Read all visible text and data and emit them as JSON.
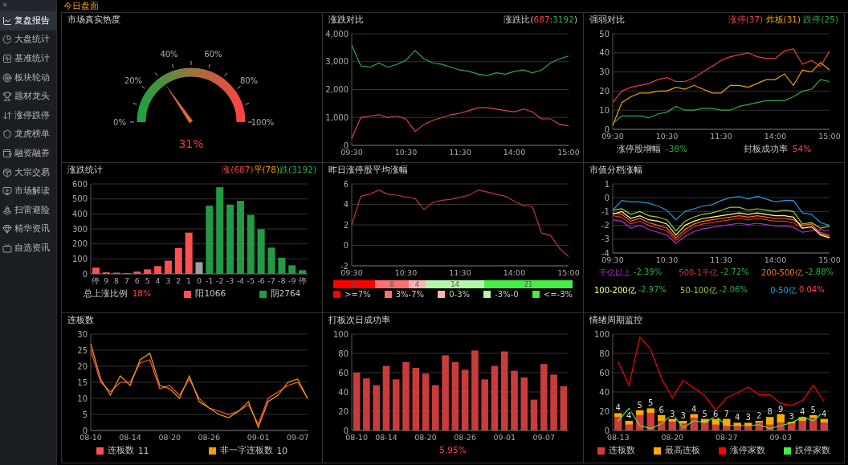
{
  "sidebar": {
    "collapse_icon": "«",
    "items": [
      {
        "label": "复盘报告",
        "selected": true
      },
      {
        "label": "大盘统计",
        "selected": false
      },
      {
        "label": "基准统计",
        "selected": false
      },
      {
        "label": "板块轮动",
        "selected": false
      },
      {
        "label": "题材龙头",
        "selected": false
      },
      {
        "label": "涨停跌停",
        "selected": false
      },
      {
        "label": "龙虎榜单",
        "selected": false
      },
      {
        "label": "融资融券",
        "selected": false
      },
      {
        "label": "大宗交易",
        "selected": false
      },
      {
        "label": "市场解读",
        "selected": false
      },
      {
        "label": "扫雷避险",
        "selected": false
      },
      {
        "label": "精华资讯",
        "selected": false
      },
      {
        "label": "自选资讯",
        "selected": false
      }
    ]
  },
  "header": {
    "title": "今日盘面"
  },
  "panels": [
    {
      "kind": "gauge",
      "title": "市场真实热度",
      "gauge": {
        "level": 0.31,
        "reading": "31%",
        "tick_labels": [
          "0%",
          "20%",
          "40%",
          "60%",
          "80%",
          "100%"
        ]
      }
    },
    {
      "kind": "chart",
      "title": "涨跌对比",
      "header_parts": [
        {
          "text": "涨跌比("
        },
        {
          "text": "687",
          "color": "#ff4040"
        },
        {
          "text": ":"
        },
        {
          "text": "3192",
          "color": "#2eaa4a"
        },
        {
          "text": ")"
        }
      ],
      "chart_data": {
        "type": "line",
        "grid": true,
        "categories": [
          "09:30",
          null,
          null,
          null,
          null,
          null,
          "10:30",
          null,
          null,
          null,
          null,
          null,
          "11:30",
          null,
          null,
          null,
          null,
          null,
          "14:00",
          null,
          null,
          null,
          null,
          null,
          "15:00"
        ],
        "ylim": [
          0,
          4000
        ],
        "yticks": [
          0,
          {
            "value": 1000,
            "label": "1,000"
          },
          {
            "value": 2000,
            "label": "2,000"
          },
          {
            "value": 3000,
            "label": "3,000"
          },
          {
            "value": 4000,
            "label": "4,000"
          }
        ],
        "series": [
          {
            "color": "#e84040",
            "values": [
              250,
              1000,
              1050,
              1100,
              1000,
              1050,
              950,
              500,
              750,
              900,
              1000,
              1100,
              1150,
              1250,
              1350,
              1350,
              1300,
              1250,
              1200,
              1300,
              1200,
              950,
              950,
              750,
              700
            ]
          },
          {
            "color": "#2eaa4a",
            "values": [
              3600,
              2850,
              2800,
              2950,
              2800,
              2900,
              3050,
              3400,
              3100,
              2950,
              2900,
              2800,
              2700,
              2650,
              2550,
              2500,
              2600,
              2550,
              2650,
              2700,
              2600,
              2700,
              2950,
              3100,
              3200
            ]
          }
        ]
      }
    },
    {
      "kind": "chart",
      "title": "强弱对比",
      "series_in_header": true,
      "chart_data": {
        "type": "line",
        "grid": true,
        "categories": [
          "09:30",
          null,
          null,
          null,
          null,
          null,
          "10:30",
          null,
          null,
          null,
          null,
          null,
          "11:30",
          null,
          null,
          null,
          null,
          null,
          "14:00",
          null,
          null,
          null,
          null,
          null,
          "15:00"
        ],
        "ylim": [
          0,
          50
        ],
        "yticks": [
          0,
          10,
          20,
          30,
          40,
          50
        ],
        "series": [
          {
            "name": "涨停(37)",
            "color": "#e84040",
            "values": [
              14,
              20,
              22,
              23,
              24,
              26,
              27,
              25,
              25,
              27,
              30,
              33,
              36,
              38,
              39,
              40,
              38,
              37,
              37,
              41,
              42,
              34,
              36,
              33,
              41
            ]
          },
          {
            "name": "炸板(31)",
            "color": "#f0a000",
            "values": [
              2,
              14,
              17,
              19,
              19,
              20,
              20,
              22,
              21,
              23,
              21,
              19,
              19,
              23,
              23,
              22,
              24,
              26,
              26,
              29,
              23,
              31,
              30,
              35,
              31
            ]
          },
          {
            "name": "跌停(25)",
            "color": "#2eaa4a",
            "values": [
              3,
              7,
              7,
              7,
              6,
              8,
              9,
              12,
              10,
              10,
              11,
              11,
              10,
              10,
              12,
              13,
              14,
              15,
              15,
              15,
              17,
              20,
              21,
              26,
              25
            ]
          }
        ]
      },
      "footer": [
        {
          "kind": "stat",
          "label": "涨停股增幅",
          "value": "-38%",
          "color": "#2eaa4a"
        },
        {
          "kind": "stat",
          "label": "封板成功率",
          "value": "54%",
          "color": "#ff4040"
        }
      ]
    },
    {
      "kind": "chart",
      "title": "涨跌统计",
      "header_parts": [
        {
          "text": "涨(687)",
          "color": "#ff4040"
        },
        {
          "text": "平(78)",
          "color": "#f0a000"
        },
        {
          "text": "跌(3192)",
          "color": "#2eaa4a"
        }
      ],
      "chart_data": {
        "type": "bar",
        "grid": true,
        "categories": [
          "停",
          "9",
          "8",
          "7",
          "6",
          "5",
          "4",
          "3",
          "2",
          "1",
          "0",
          "-1",
          "-2",
          "-3",
          "-4",
          "-5",
          "-6",
          "-7",
          "-8",
          "-9",
          "停"
        ],
        "ylim": [
          0,
          600
        ],
        "yticks": [
          0,
          100,
          200,
          300,
          400,
          500,
          600
        ],
        "series": [
          {
            "color": "#ff5050",
            "values": [
              42,
              10,
              8,
              5,
              15,
              30,
              52,
              88,
              172,
              275,
              null,
              null,
              null,
              null,
              null,
              null,
              null,
              null,
              null,
              null,
              null
            ]
          },
          {
            "color": "#a0a0a0",
            "values": [
              null,
              null,
              null,
              null,
              null,
              null,
              null,
              null,
              null,
              null,
              78,
              null,
              null,
              null,
              null,
              null,
              null,
              null,
              null,
              null,
              null
            ]
          },
          {
            "color": "#239b44",
            "values": [
              null,
              null,
              null,
              null,
              null,
              null,
              null,
              null,
              null,
              null,
              null,
              455,
              578,
              462,
              487,
              393,
              298,
              175,
              108,
              57,
              25
            ]
          }
        ]
      },
      "footer": [
        {
          "kind": "stat",
          "label": "总上涨比例",
          "value": "18%",
          "color": "#ff4040"
        },
        {
          "kind": "swatch",
          "label": "阳1066",
          "color": "#ff5050"
        },
        {
          "kind": "swatch",
          "label": "阴2764",
          "color": "#239b44"
        }
      ]
    },
    {
      "kind": "chart",
      "title": "昨日涨停股平均涨幅",
      "chart_data": {
        "type": "line",
        "grid": true,
        "categories": [
          "09:30",
          null,
          null,
          null,
          null,
          null,
          "10:30",
          null,
          null,
          null,
          null,
          null,
          "11:30",
          null,
          null,
          null,
          null,
          null,
          "14:00",
          null,
          null,
          null,
          null,
          null,
          "15:00"
        ],
        "ylim": [
          -2,
          6
        ],
        "yticks": [
          -2,
          0,
          2,
          4,
          6
        ],
        "series": [
          {
            "color": "#c83232",
            "values": [
              2,
              4.8,
              5,
              5.4,
              5.0,
              4.9,
              4.7,
              4.6,
              3.5,
              4.2,
              4.4,
              4.5,
              4.7,
              4.9,
              5.4,
              5.2,
              5.0,
              4.8,
              4.3,
              3.9,
              3.8,
              1.2,
              1.0,
              -0.3,
              -1.1
            ]
          }
        ]
      },
      "footer": [
        {
          "kind": "distribution",
          "segments": [
            {
              "count": "10",
              "label": ">=7%",
              "color": "#ff0000"
            },
            {
              "count": "8",
              "label": "3%-7%",
              "color": "#ff7070"
            },
            {
              "count": "4",
              "label": "0-3%",
              "color": "#ffb4b4"
            },
            {
              "count": "14",
              "label": "-3%-0",
              "color": "#b4f5aa"
            },
            {
              "count": "21",
              "label": "<=-3%",
              "color": "#44ee44"
            }
          ]
        }
      ]
    },
    {
      "kind": "chart",
      "title": "市值分档涨幅",
      "chart_data": {
        "type": "line",
        "grid": true,
        "categories": [
          "09:30",
          null,
          null,
          null,
          null,
          null,
          "10:30",
          null,
          null,
          null,
          null,
          null,
          "11:30",
          null,
          null,
          null,
          null,
          null,
          "14:00",
          null,
          null,
          null,
          null,
          null,
          "15:00"
        ],
        "ylim": [
          -4,
          1
        ],
        "yticks": [
          -4,
          -3,
          -2,
          -1,
          0,
          1
        ],
        "series": [
          {
            "name": "千亿以上",
            "color": "#b030d0",
            "values": [
              -1.6,
              -1.7,
              -2.2,
              -2.0,
              -2.3,
              -2.5,
              -2.7,
              -3.3,
              -2.8,
              -2.45,
              -2.25,
              -2.15,
              -2.05,
              -1.95,
              -1.85,
              -1.95,
              -1.85,
              -1.95,
              -2.05,
              -2.05,
              -2.15,
              -2.5,
              -2.4,
              -2.3,
              -2.4
            ]
          },
          {
            "name": "500-1千亿",
            "color": "#e03030",
            "values": [
              -1.3,
              -1.4,
              -1.9,
              -1.7,
              -2.0,
              -2.2,
              -2.4,
              -3.1,
              -2.5,
              -2.1,
              -1.9,
              -1.8,
              -1.7,
              -1.6,
              -1.5,
              -1.6,
              -1.5,
              -1.6,
              -1.7,
              -1.7,
              -1.8,
              -2.2,
              -2.1,
              -2.5,
              -2.7
            ]
          },
          {
            "name": "200-500亿",
            "color": "#ff7020",
            "values": [
              -1.1,
              -1.2,
              -1.7,
              -1.5,
              -1.8,
              -2.0,
              -2.2,
              -2.9,
              -2.3,
              -1.9,
              -1.7,
              -1.6,
              -1.5,
              -1.4,
              -1.3,
              -1.4,
              -1.3,
              -1.4,
              -1.5,
              -1.5,
              -1.6,
              -2.0,
              -1.9,
              -2.6,
              -2.8
            ]
          },
          {
            "name": "100-200亿",
            "color": "#ffff90",
            "values": [
              -1.2,
              -1.0,
              -1.5,
              -1.3,
              -1.6,
              -1.7,
              -1.9,
              -2.7,
              -2.0,
              -1.7,
              -1.5,
              -1.4,
              -1.3,
              -1.2,
              -1.1,
              -1.2,
              -1.1,
              -1.2,
              -1.3,
              -1.3,
              -1.4,
              -2.2,
              -2.1,
              -2.7,
              -2.9
            ]
          },
          {
            "name": "50-100亿",
            "color": "#9acd32",
            "values": [
              -0.9,
              -0.8,
              -1.2,
              -1.0,
              -1.3,
              -1.4,
              -1.6,
              -2.4,
              -1.7,
              -1.4,
              -1.2,
              -1.1,
              -0.9,
              -0.7,
              -0.7,
              -0.9,
              -0.8,
              -0.9,
              -1.0,
              -0.9,
              -1.0,
              -1.9,
              -1.8,
              -2.2,
              -2.06
            ]
          },
          {
            "name": "0-50亿",
            "color": "#1e9be0",
            "values": [
              -0.9,
              -0.2,
              -0.3,
              -0.3,
              -0.4,
              -0.6,
              -0.9,
              -1.6,
              -1.0,
              -0.8,
              -0.6,
              -0.5,
              -0.2,
              0,
              0.1,
              -0.1,
              0.1,
              -0.1,
              -0.3,
              -0.2,
              -0.2,
              -1.1,
              -1.2,
              -1.8,
              -2.0
            ]
          }
        ]
      },
      "footer": [
        {
          "kind": "series_values",
          "items": [
            {
              "value": "-2.39%",
              "color": "#2eaa4a"
            },
            {
              "value": "-2.72%",
              "color": "#2eaa4a"
            },
            {
              "value": "-2.88%",
              "color": "#2eaa4a"
            },
            {
              "value": "-2.97%",
              "color": "#2eaa4a"
            },
            {
              "value": "-2.06%",
              "color": "#2eaa4a"
            },
            {
              "value": "0.04%",
              "color": "#ff4040"
            }
          ]
        }
      ]
    },
    {
      "kind": "chart",
      "title": "连板数",
      "chart_data": {
        "type": "line",
        "grid": true,
        "categories": [
          "08-10",
          null,
          null,
          null,
          "08-14",
          null,
          null,
          null,
          "08-20",
          null,
          null,
          null,
          "08-26",
          null,
          null,
          null,
          null,
          "09-01",
          null,
          null,
          null,
          "09-07",
          null
        ],
        "ylim": [
          0,
          30
        ],
        "yticks": [
          0,
          5,
          10,
          15,
          20,
          25,
          30
        ],
        "series": [
          {
            "name": "连板数",
            "color": "#ff5050",
            "values": [
              25,
              15,
              12,
              15,
              15,
              21,
              22,
              13,
              14,
              11,
              16,
              10,
              7,
              6,
              5,
              6,
              8,
              2,
              10,
              12,
              14,
              15,
              10
            ]
          },
          {
            "name": "非一字连板数",
            "color": "#f0a000",
            "values": [
              27,
              16,
              11,
              17,
              14,
              22,
              24,
              14,
              13,
              10,
              17,
              9,
              7,
              5,
              4,
              6,
              9,
              1,
              9,
              11,
              15,
              16,
              10
            ]
          }
        ]
      },
      "footer": [
        {
          "kind": "series_legend",
          "items": [
            {
              "value": "11"
            },
            {
              "value": "10"
            }
          ]
        }
      ]
    },
    {
      "kind": "chart",
      "title": "打板次日成功率",
      "chart_data": {
        "type": "bar",
        "grid": true,
        "categories": [
          "08-10",
          null,
          null,
          "08-14",
          null,
          null,
          null,
          "08-20",
          null,
          null,
          null,
          "08-26",
          null,
          null,
          null,
          "09-01",
          null,
          null,
          null,
          "09-07",
          null,
          null
        ],
        "ylim": [
          0,
          100
        ],
        "yticks": [
          0,
          20,
          40,
          60,
          80,
          100
        ],
        "series": [
          {
            "color": "#c83c3c",
            "values": [
              60,
              54,
              47,
              67,
              53,
              71,
              65,
              59,
              47,
              78,
              71,
              63,
              83,
              53,
              67,
              82,
              62,
              55,
              32,
              69,
              58,
              46
            ]
          }
        ]
      },
      "footer": [
        {
          "kind": "note",
          "text": "5.95%",
          "color": "#ff4040"
        }
      ]
    },
    {
      "kind": "chart",
      "title": "情绪周期监控",
      "chart_data": {
        "type": "bar",
        "grid": true,
        "stacked": true,
        "categories": [
          "08-13",
          null,
          null,
          null,
          null,
          "08-20",
          null,
          null,
          null,
          null,
          "08-27",
          null,
          null,
          null,
          null,
          "09-03",
          null,
          null,
          null,
          null
        ],
        "ylim": [
          0,
          100
        ],
        "yticks": [
          0,
          20,
          40,
          60,
          80,
          100
        ],
        "value_labels": [
          "4",
          "4",
          "5",
          "5",
          "6",
          "3",
          "3",
          "4",
          "5",
          "6",
          "7",
          "4",
          "3",
          "2",
          "8",
          "9",
          "3",
          "4",
          "5",
          "4"
        ],
        "series": [
          {
            "name": "连板数",
            "color": "#d03c3c",
            "values": [
              14,
              6,
              16,
              18,
              10,
              9,
              7,
              13,
              8,
              6,
              5,
              5,
              5,
              8,
              6,
              8,
              7,
              10,
              13,
              8
            ]
          },
          {
            "name": "最高连板",
            "color": "#ffaa00",
            "values": [
              4,
              4,
              5,
              5,
              6,
              3,
              3,
              4,
              4,
              6,
              7,
              3,
              3,
              2,
              8,
              9,
              2,
              4,
              3,
              4
            ]
          },
          {
            "name": "涨停家数",
            "type": "line",
            "color": "#ff0000",
            "values": [
              71,
              47,
              97,
              84,
              54,
              34,
              52,
              44,
              36,
              21,
              34,
              39,
              45,
              37,
              37,
              28,
              26,
              31,
              47,
              30
            ]
          },
          {
            "name": "跌停家数",
            "type": "line",
            "color": "#44ee44",
            "values": [
              10,
              23,
              5,
              2,
              7,
              17,
              3,
              10,
              8,
              15,
              5,
              5,
              5,
              6,
              2,
              5,
              8,
              14,
              10,
              20
            ]
          }
        ]
      },
      "footer": [
        {
          "kind": "series_legend"
        }
      ]
    }
  ]
}
